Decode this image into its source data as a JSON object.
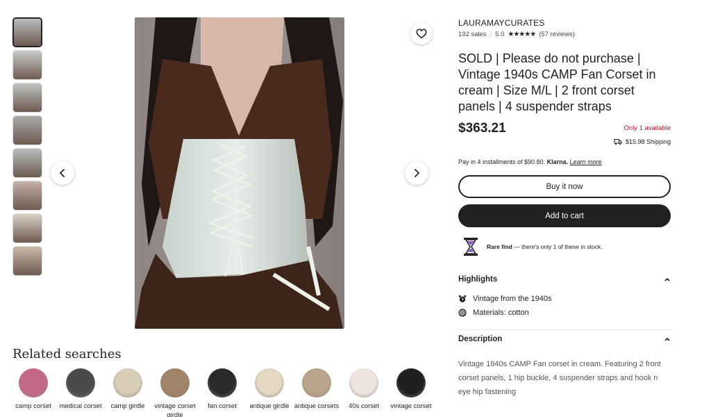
{
  "gallery": {
    "thumbnails": [
      {
        "color": "#b9bcbd"
      },
      {
        "color": "#c9ccc9"
      },
      {
        "color": "#bfc3c0"
      },
      {
        "color": "#a8aba9"
      },
      {
        "color": "#b7bebd"
      },
      {
        "color": "#c7b0a6"
      },
      {
        "color": "#d8d0c4"
      },
      {
        "color": "#cbb9a8"
      }
    ],
    "prev_icon": "chevron-left-icon",
    "next_icon": "chevron-right-icon",
    "favorite_icon": "heart-icon"
  },
  "related": {
    "title": "Related searches",
    "items": [
      {
        "label": "camp corset",
        "color": "#c56a86"
      },
      {
        "label": "medical corset",
        "color": "#4a4a48"
      },
      {
        "label": "camp girdle",
        "color": "#d8cdb8"
      },
      {
        "label": "vintage corset girdle",
        "color": "#a08368"
      },
      {
        "label": "fan corset",
        "color": "#2a2a2c"
      },
      {
        "label": "antique girdle",
        "color": "#e3d8c1"
      },
      {
        "label": "antique corsets",
        "color": "#b9a58b"
      },
      {
        "label": "40s corset",
        "color": "#f0e4e0"
      },
      {
        "label": "vintage corset",
        "color": "#1f1f22"
      }
    ]
  },
  "listing": {
    "shop_name": "LAURAMAYCURATES",
    "sales": "192 sales",
    "rating": "5.0",
    "stars": "★★★★★",
    "reviews": "(57 reviews)",
    "title": "SOLD | Please do not purchase | Vintage 1940s CAMP Fan Corset in cream | Size M/L | 2 front corset panels | 4 suspender straps",
    "price": "$363.21",
    "availability": "Only 1 available",
    "shipping": "$15.98 Shipping",
    "installments": "Pay in 4 installments of $90.80.",
    "klarna": "Klarna.",
    "learn_more": "Learn more",
    "buy_now": "Buy it now",
    "add_to_cart": "Add to cart",
    "rare_bold": "Rare find",
    "rare_text": " — there's only 1 of these in stock.",
    "accent": "#a61a2e"
  },
  "highlights": {
    "title": "Highlights",
    "items": [
      {
        "icon": "alarm-clock-icon",
        "text": "Vintage from the 1940s"
      },
      {
        "icon": "materials-icon",
        "text": "Materials: cotton"
      }
    ]
  },
  "description": {
    "title": "Description",
    "text": "Vintage 1940s CAMP Fan corset in cream. Featuring 2 front corset panels, 1 hip buckle, 4 suspender straps and hook n eye hip fastening"
  }
}
